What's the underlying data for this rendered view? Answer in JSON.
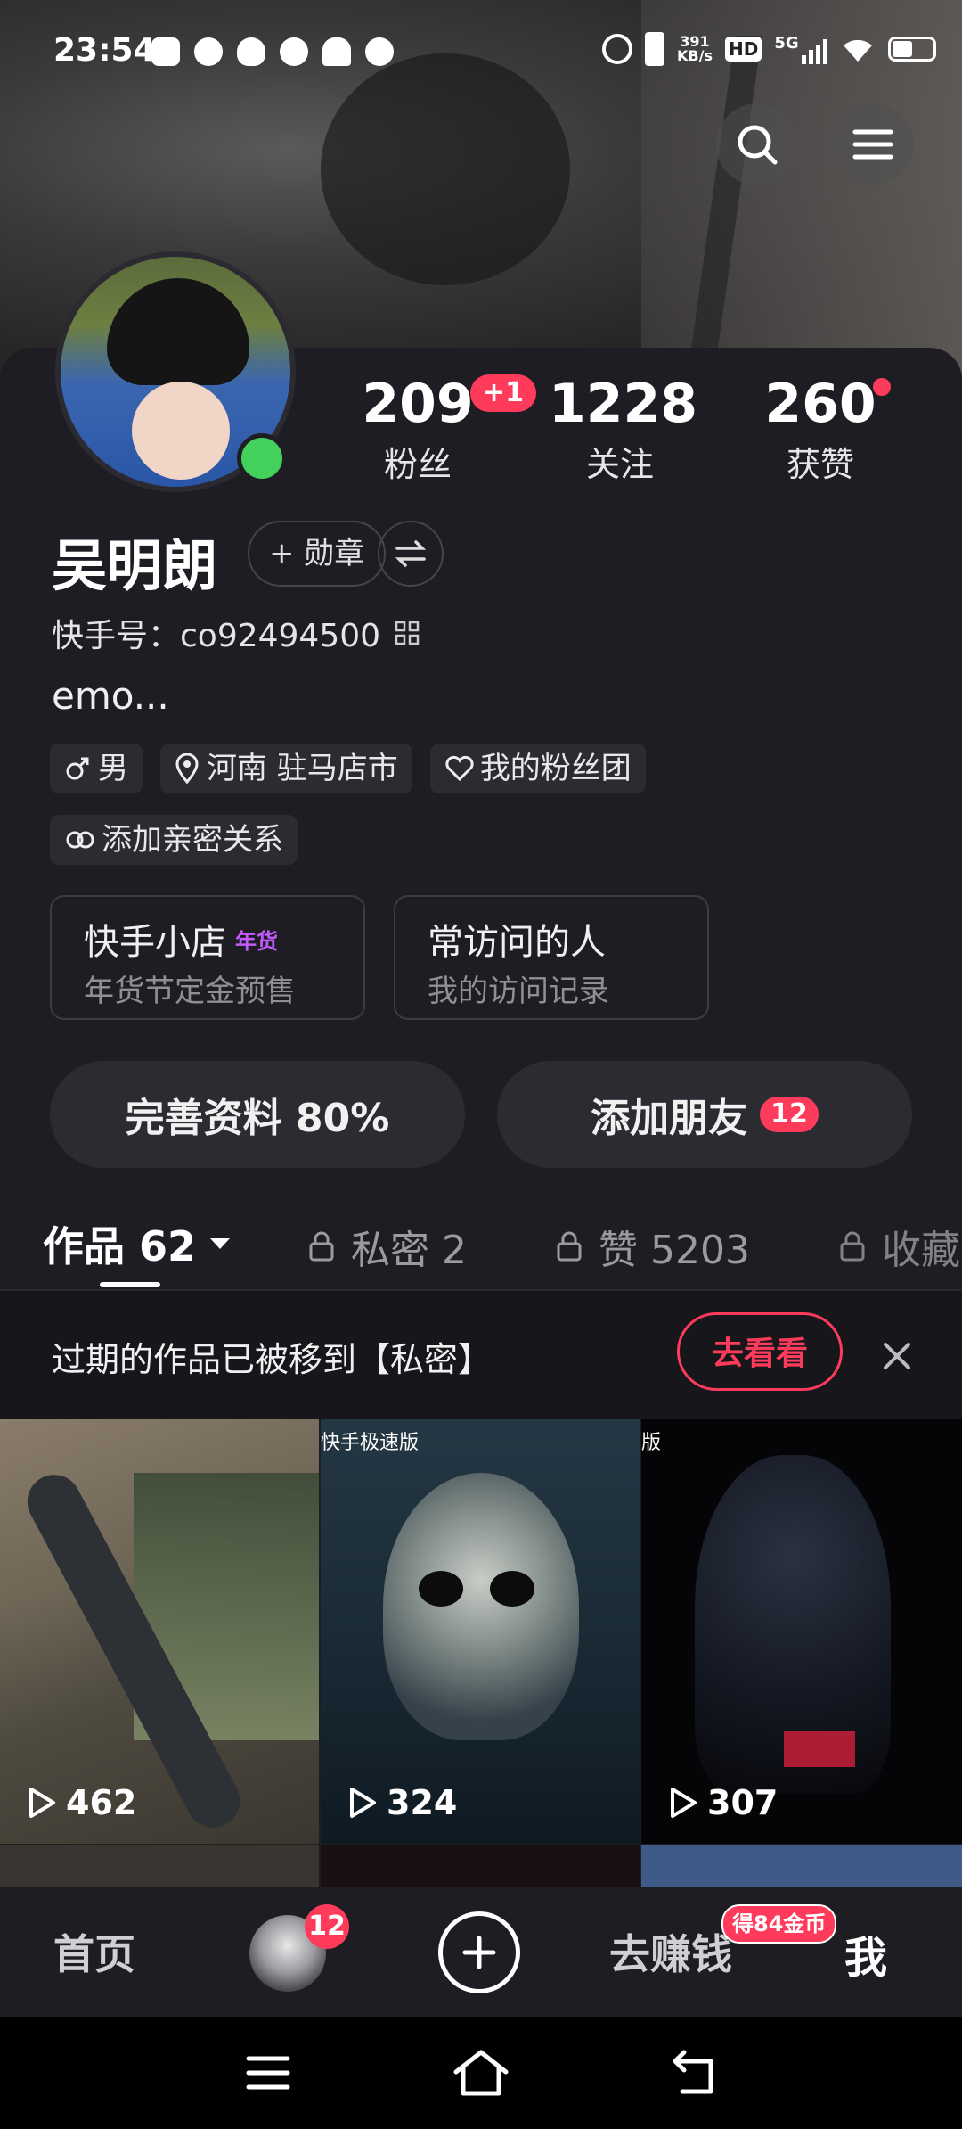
{
  "status_bar": {
    "time": "23:54",
    "net_speed_value": "391",
    "net_speed_unit": "KB/s",
    "hd": "HD",
    "network": "5G"
  },
  "header": {
    "search_icon": "search-icon",
    "menu_icon": "menu-icon"
  },
  "stats": [
    {
      "value": "209",
      "label": "粉丝",
      "badge": "+1"
    },
    {
      "value": "1228",
      "label": "关注"
    },
    {
      "value": "260",
      "label": "获赞"
    }
  ],
  "profile": {
    "name": "吴明朗",
    "medal_button": "+ 勋章",
    "id_label": "快手号：co92494500",
    "bio": "emo...",
    "tags": [
      "男",
      "河南 驻马店市",
      "我的粉丝团"
    ],
    "relation_tag": "添加亲密关系"
  },
  "cards": [
    {
      "title": "快手小店",
      "badge": "年货",
      "subtitle": "年货节定金预售"
    },
    {
      "title": "常访问的人",
      "subtitle": "我的访问记录"
    }
  ],
  "actions": {
    "complete_profile": "完善资料 80%",
    "add_friends": "添加朋友",
    "add_friends_badge": "12"
  },
  "tabs": [
    {
      "label": "作品 62",
      "active": true
    },
    {
      "label": "私密 2",
      "locked": true
    },
    {
      "label": "赞 5203",
      "locked": true
    },
    {
      "label": "收藏",
      "locked": true
    }
  ],
  "notice": {
    "text": "过期的作品已被移到【私密】",
    "button": "去看看"
  },
  "videos": [
    {
      "views": "462",
      "overlay": ""
    },
    {
      "views": "324",
      "overlay": "快手极速版"
    },
    {
      "views": "307",
      "overlay": "版"
    }
  ],
  "bottom_nav": {
    "home": "首页",
    "avatar_badge": "12",
    "earn": "去赚钱",
    "earn_badge": "得84金币",
    "me": "我"
  },
  "colors": {
    "accent": "#ff3b5c",
    "background": "#1d1d23",
    "online": "#43d15b"
  }
}
